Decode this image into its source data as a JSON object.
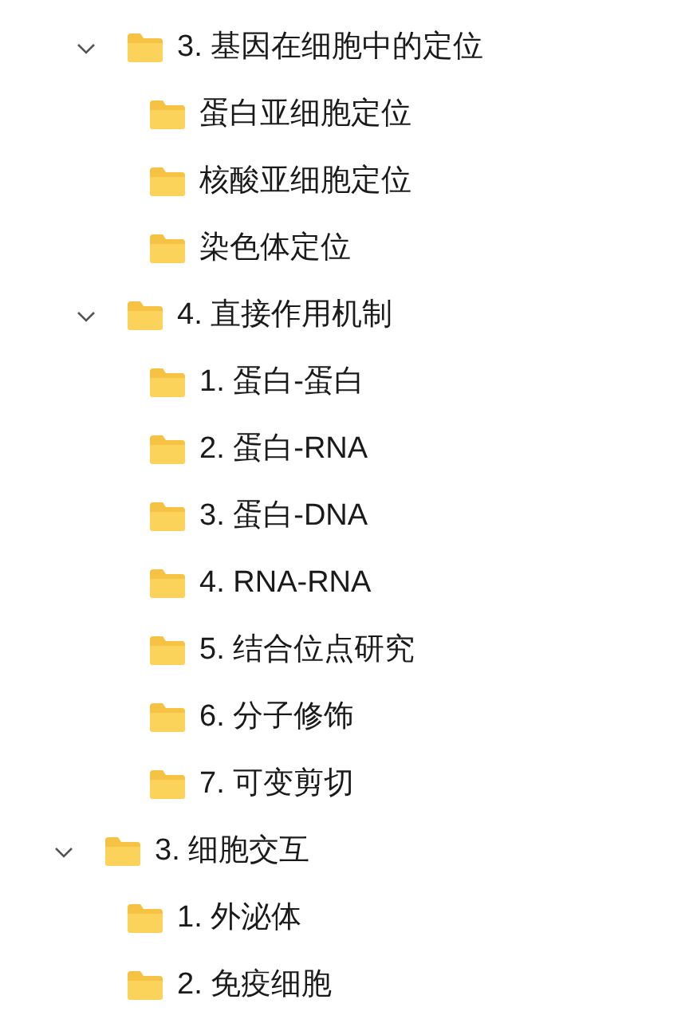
{
  "tree": [
    {
      "children": [
        {
          "label": "3. 基因在细胞中的定位",
          "expanded": true,
          "children": [
            {
              "label": "蛋白亚细胞定位"
            },
            {
              "label": "核酸亚细胞定位"
            },
            {
              "label": "染色体定位"
            }
          ]
        },
        {
          "label": "4. 直接作用机制",
          "expanded": true,
          "children": [
            {
              "label": "1. 蛋白-蛋白"
            },
            {
              "label": "2. 蛋白-RNA"
            },
            {
              "label": "3. 蛋白-DNA"
            },
            {
              "label": "4. RNA-RNA"
            },
            {
              "label": "5. 结合位点研究"
            },
            {
              "label": "6. 分子修饰"
            },
            {
              "label": "7. 可变剪切"
            }
          ]
        }
      ]
    },
    {
      "label": "3. 细胞交互",
      "expanded": true,
      "children": [
        {
          "label": "1. 外泌体"
        },
        {
          "label": "2. 免疫细胞"
        }
      ]
    }
  ]
}
